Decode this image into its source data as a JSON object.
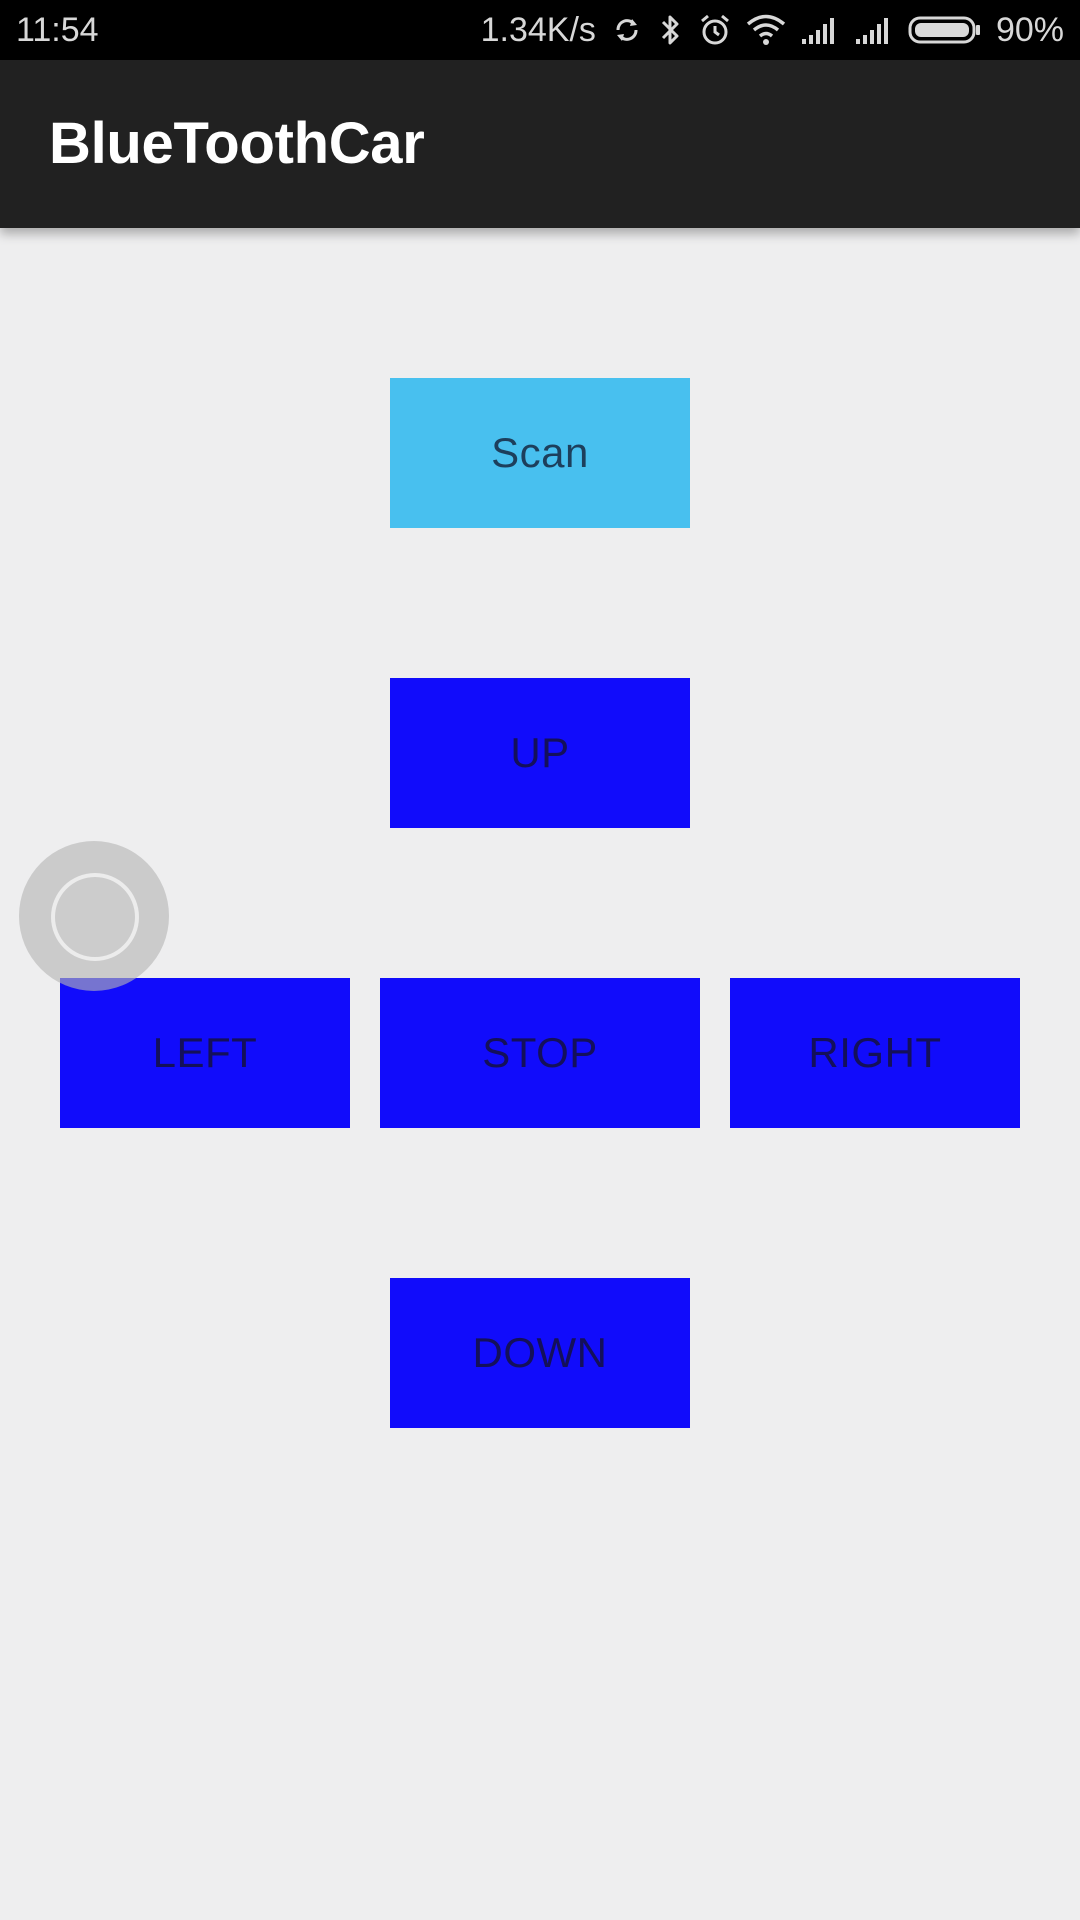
{
  "status_bar": {
    "time": "11:54",
    "network_speed": "1.34K/s",
    "battery_level": "90%",
    "icons": [
      "sync-icon",
      "bluetooth-icon",
      "alarm-icon",
      "wifi-icon",
      "signal-icon",
      "signal-icon",
      "battery-icon"
    ]
  },
  "app_bar": {
    "title": "BlueToothCar"
  },
  "controls": {
    "scan_label": "Scan",
    "up_label": "UP",
    "left_label": "LEFT",
    "stop_label": "STOP",
    "right_label": "RIGHT",
    "down_label": "DOWN"
  },
  "colors": {
    "scan_button": "#48c0ef",
    "direction_buttons": "#110cfb",
    "app_bar": "#212121",
    "background": "#eeeeef"
  }
}
